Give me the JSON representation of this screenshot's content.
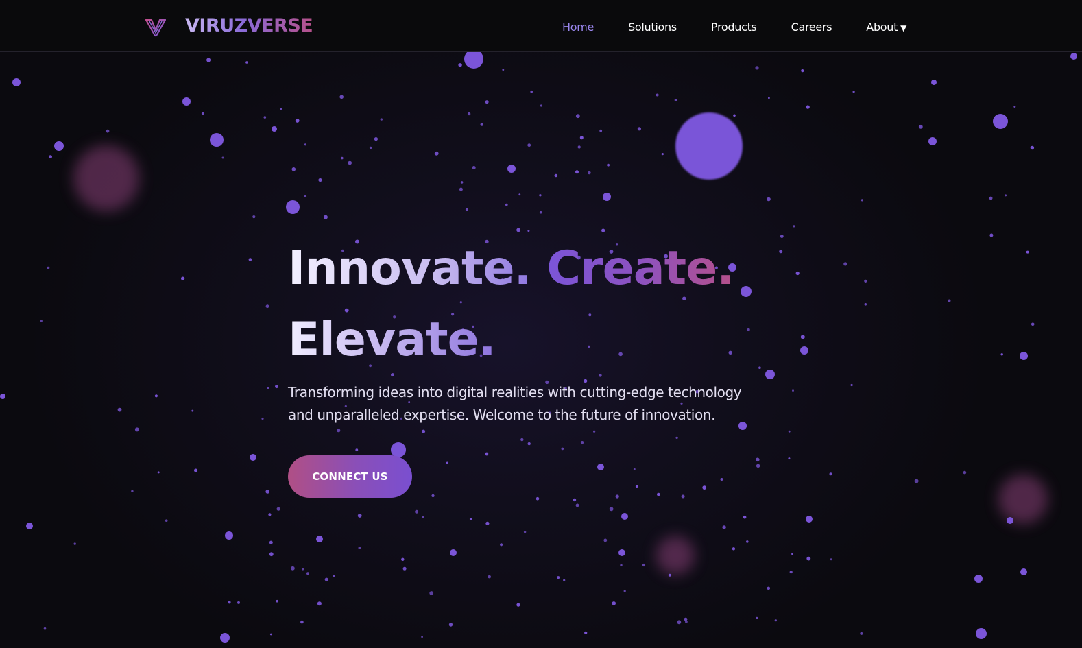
{
  "brand": {
    "name": "VIRUZVERSE",
    "logo_icon": "v-logo-icon"
  },
  "nav": {
    "items": [
      {
        "label": "Home",
        "active": true
      },
      {
        "label": "Solutions",
        "active": false
      },
      {
        "label": "Products",
        "active": false
      },
      {
        "label": "Careers",
        "active": false
      },
      {
        "label": "About",
        "active": false,
        "dropdown": true
      }
    ],
    "caret_icon": "caret-down-icon"
  },
  "hero": {
    "title_word_1": "Innovate.",
    "title_word_2": "Create.",
    "title_word_3": "Elevate.",
    "subtitle": "Transforming ideas into digital realities with cutting-edge technology and unparalleled expertise. Welcome to the future of innovation.",
    "cta_label": "CONNECT US"
  },
  "colors": {
    "background": "#0b0a0f",
    "particle": "#7b55d8",
    "accent_purple": "#8a6bd8",
    "accent_pink": "#b5508a",
    "nav_active": "#9a86ee"
  }
}
